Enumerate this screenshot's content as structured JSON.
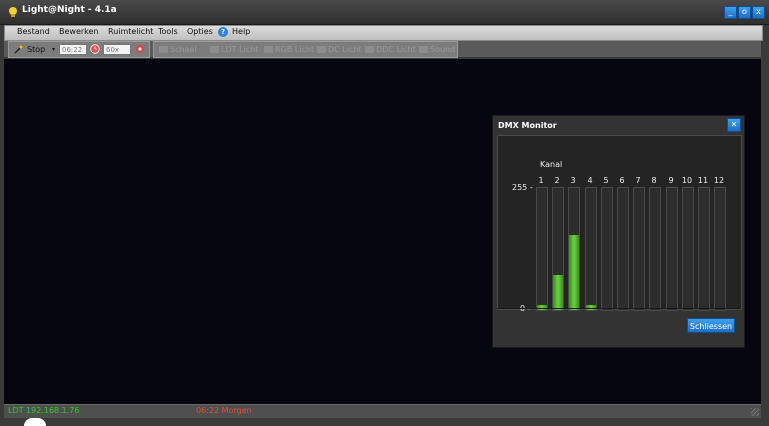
{
  "window": {
    "title": "Light@Night - 4.1a",
    "accent": "#1e6ec4",
    "controls": [
      "_",
      "o",
      "x"
    ]
  },
  "menu": {
    "items": [
      "Bestand",
      "Bewerken",
      "Ruimtelicht",
      "Tools",
      "Opties"
    ],
    "help": "Help"
  },
  "toolbar": {
    "stop_label": "Stop",
    "time_value": "06:22",
    "speed_value": "60x",
    "disabled_items": [
      "Schaal",
      "LDT Licht",
      "RGB Licht",
      "DC Licht",
      "DDC Licht",
      "Sound"
    ]
  },
  "status": {
    "left": "LDT 192.168.1.76",
    "middle": "06:22 Morgen",
    "left_color": "#33cc22",
    "middle_color": "#e05030"
  },
  "dmx_monitor": {
    "title": "DMX Monitor",
    "kanal_label": "Kanal",
    "axis_max_label": "255 -",
    "axis_min_label": "0 -",
    "max_value": 255,
    "close_button": "Schliessen",
    "channels": [
      {
        "label": "1",
        "value": 10
      },
      {
        "label": "2",
        "value": 75
      },
      {
        "label": "3",
        "value": 160
      },
      {
        "label": "4",
        "value": 10
      },
      {
        "label": "5",
        "value": 0
      },
      {
        "label": "6",
        "value": 0
      },
      {
        "label": "7",
        "value": 0
      },
      {
        "label": "8",
        "value": 0
      },
      {
        "label": "9",
        "value": 0
      },
      {
        "label": "10",
        "value": 0
      },
      {
        "label": "11",
        "value": 0
      },
      {
        "label": "12",
        "value": 0
      }
    ]
  }
}
